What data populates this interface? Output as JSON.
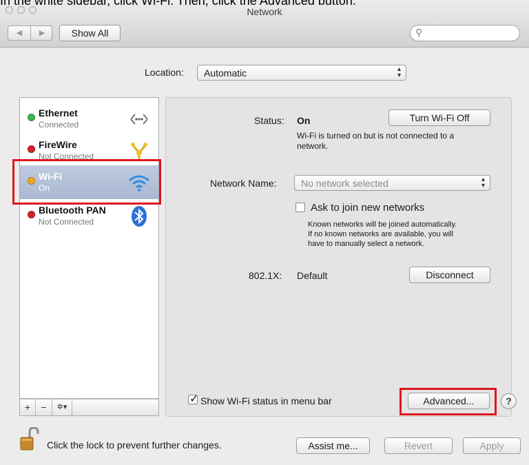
{
  "instruction": {
    "text": "In the white sidebar, click Wi-Fi. Then, click the Advanced button."
  },
  "window": {
    "title": "Network"
  },
  "toolbar": {
    "back": "◀",
    "forward": "▶",
    "show_all": "Show All",
    "search_placeholder": ""
  },
  "location": {
    "label": "Location:",
    "value": "Automatic"
  },
  "sidebar": {
    "items": [
      {
        "name": "Ethernet",
        "status": "Connected",
        "dot_color": "#3cb648",
        "icon": "ethernet-icon"
      },
      {
        "name": "FireWire",
        "status": "Not Connected",
        "dot_color": "#d8202b",
        "icon": "firewire-icon"
      },
      {
        "name": "Wi-Fi",
        "status": "On",
        "dot_color": "#f3a81e",
        "icon": "wifi-icon"
      },
      {
        "name": "Bluetooth PAN",
        "status": "Not Connected",
        "dot_color": "#d8202b",
        "icon": "bluetooth-icon"
      }
    ],
    "tools": {
      "add": "+",
      "remove": "−",
      "action": "✲▾"
    }
  },
  "panel": {
    "status_label": "Status:",
    "status_value": "On",
    "toggle_button": "Turn Wi-Fi Off",
    "status_desc_1": "Wi-Fi is turned on but is not connected to a",
    "status_desc_2": "network.",
    "network_name_label": "Network Name:",
    "network_name_value": "No network selected",
    "ask_join_label": "Ask to join new networks",
    "ask_desc_1": "Known networks will be joined automatically.",
    "ask_desc_2": "If no known networks are available, you will",
    "ask_desc_3": "have to manually select a network.",
    "dot1x_label": "802.1X:",
    "dot1x_value": "Default",
    "disconnect_button": "Disconnect",
    "show_status_label": "Show Wi-Fi status in menu bar",
    "advanced_button": "Advanced...",
    "help": "?"
  },
  "footer": {
    "lock_text": "Click the lock to prevent further changes.",
    "assist_button": "Assist me...",
    "revert_button": "Revert",
    "apply_button": "Apply"
  },
  "colors": {
    "highlight": "#e0161e",
    "selection": "#a9b8d3"
  }
}
